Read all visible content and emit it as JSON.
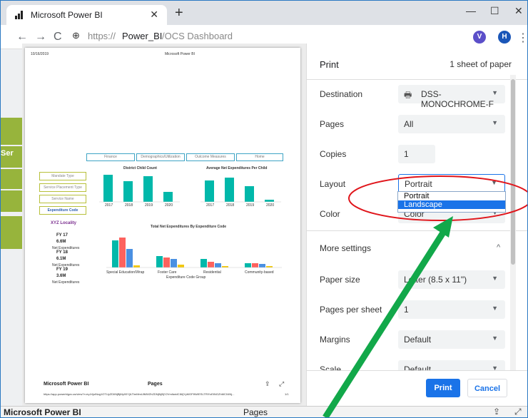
{
  "browser": {
    "tab_title": "Microsoft Power BI",
    "url_prefix": "https://",
    "url_host": "Power_BI",
    "url_path": "/OCS Dashboard",
    "profile_initial": "H",
    "ext_initial": "V"
  },
  "preview": {
    "date": "10/16/2019",
    "header_title": "Microsoft Power BI",
    "tabs": [
      "Finance",
      "Demographics/Utilization",
      "Outcome Measures",
      "Home"
    ],
    "slicers": [
      "Mandate Type",
      "Service Placement Type",
      "Service Name",
      "Expenditure Code"
    ],
    "locality": "XYZ Locality",
    "kpis": [
      {
        "fy": "FY 17",
        "val": "6.6M",
        "lbl": "Net Expenditures"
      },
      {
        "fy": "FY 18",
        "val": "6.1M",
        "lbl": "Net Expenditures"
      },
      {
        "fy": "FY 19",
        "val": "3.6M",
        "lbl": "Net Expenditures"
      }
    ],
    "chart1_title": "District Child Count",
    "chart2_title": "Average Net Expenditures Per Child",
    "chart3_title": "Total Net Expenditures By Expenditure Code",
    "chart1_x": [
      "2017",
      "2018",
      "2019",
      "2020"
    ],
    "chart2_x": [
      "2017",
      "2018",
      "2019",
      "2020"
    ],
    "chart3_x": [
      "Special Education/Wrap",
      "Foster Care",
      "Residential",
      "Community-based"
    ],
    "chart3_xlabel": "Expenditure Code Group",
    "footer_left": "Microsoft Power BI",
    "footer_center": "Pages",
    "footer_url": "https://app.powerbigov.us/view?r=eyJrIjoiNzg1OTUyZDIiNjBjMy00YjlLTlmMmUlMWZhZDNjNjBjY2VmIiwidCI6IjYyMGFlNWESLTRlYzEtNGZhMC04Nj...",
    "footer_page": "1/1"
  },
  "print": {
    "title": "Print",
    "sheets": "1 sheet of paper",
    "destination_label": "Destination",
    "destination_value": "DSS-MONOCHROME-F",
    "pages_label": "Pages",
    "pages_value": "All",
    "copies_label": "Copies",
    "copies_value": "1",
    "layout_label": "Layout",
    "layout_value": "Portrait",
    "layout_options": [
      "Portrait",
      "Landscape"
    ],
    "color_label": "Color",
    "color_value": "Color",
    "more_label": "More settings",
    "paper_label": "Paper size",
    "paper_value": "Letter (8.5 x 11\")",
    "pps_label": "Pages per sheet",
    "pps_value": "1",
    "margins_label": "Margins",
    "margins_value": "Default",
    "scale_label": "Scale",
    "scale_value": "Default",
    "print_btn": "Print",
    "cancel_btn": "Cancel"
  },
  "status": {
    "left": "Microsoft Power BI",
    "center": "Pages"
  },
  "background": {
    "sidebar_label": "Ser"
  },
  "colors": {
    "accent": "#1a73e8",
    "teal": "#01b8aa",
    "red": "#fd625e",
    "annotation": "#e0151b",
    "arrow": "#12a84a"
  }
}
